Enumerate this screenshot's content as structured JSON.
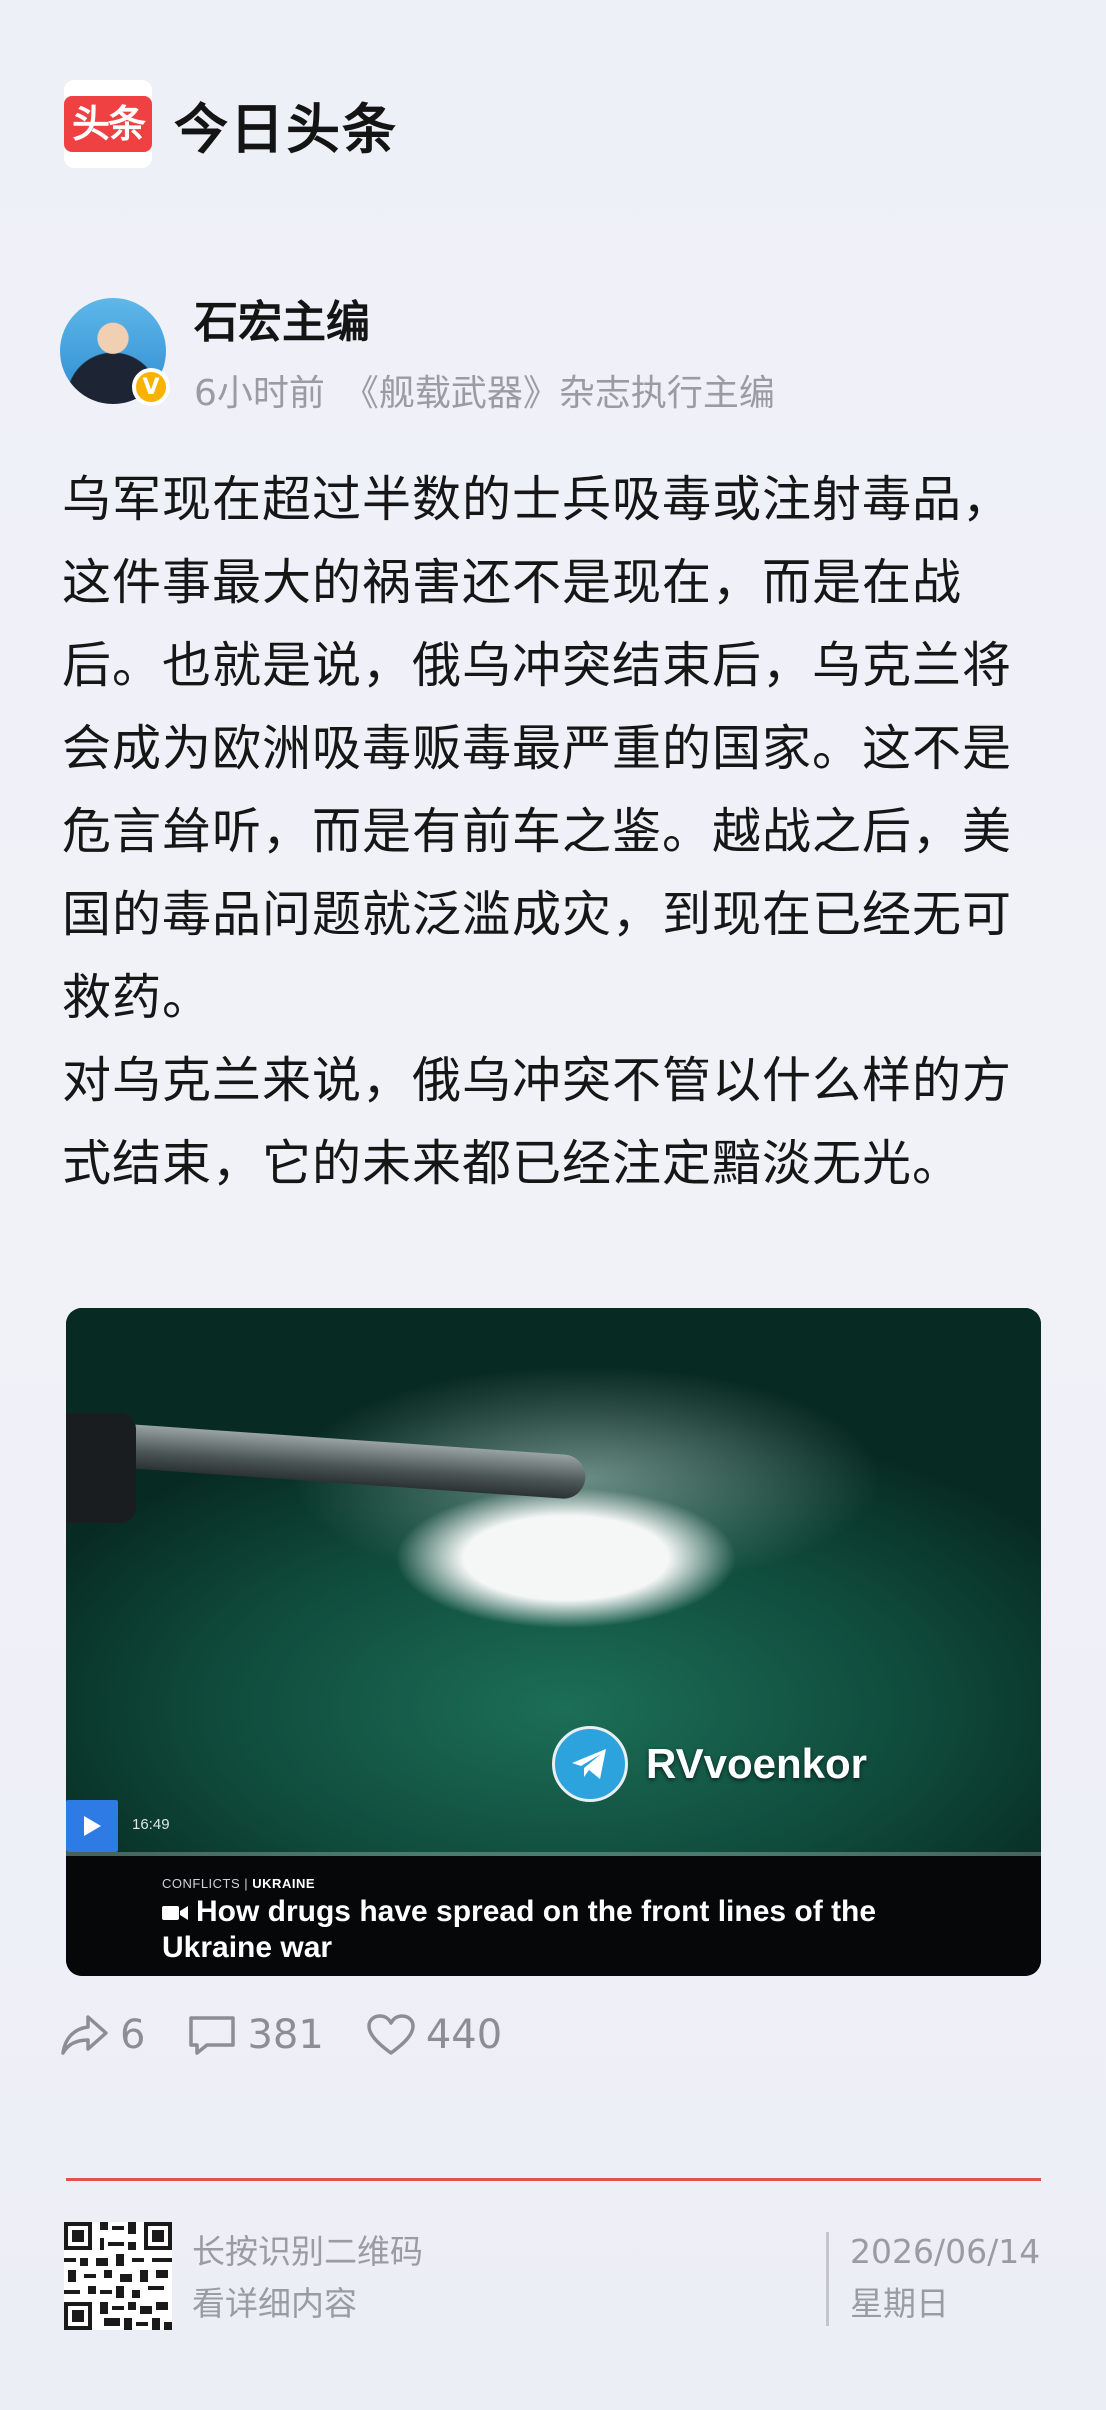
{
  "header": {
    "logo_text": "头条",
    "app_name": "今日头条"
  },
  "author": {
    "name": "石宏主编",
    "verified_badge": "V",
    "time_ago": "6小时前",
    "title": "《舰载武器》杂志执行主编"
  },
  "post": {
    "paragraphs": [
      "乌军现在超过半数的士兵吸毒或注射毒品，这件事最大的祸害还不是现在，而是在战后。也就是说，俄乌冲突结束后，乌克兰将会成为欧洲吸毒贩毒最严重的国家。这不是危言耸听，而是有前车之鉴。越战之后，美国的毒品问题就泛滥成灾，到现在已经无可救药。",
      "对乌克兰来说，俄乌冲突不管以什么样的方式结束，它的未来都已经注定黯淡无光。"
    ]
  },
  "media": {
    "watermark": "RVvoenkor",
    "duration": "16:49",
    "tag_category": "CONFLICTS",
    "tag_region": "UKRAINE",
    "caption": "How drugs have spread on the front lines of the Ukraine war"
  },
  "stats": {
    "shares": "6",
    "comments": "381",
    "likes": "440"
  },
  "footer": {
    "qr_line1": "长按识别二维码",
    "qr_line2": "看详细内容",
    "date": "2026/06/14",
    "weekday": "星期日"
  },
  "colors": {
    "accent_red": "#f04142",
    "divider_red": "#e8504e",
    "muted_gray": "#9a9ca3"
  }
}
